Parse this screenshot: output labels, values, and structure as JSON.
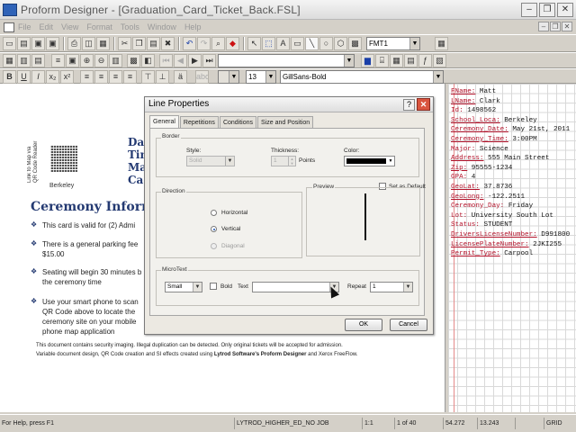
{
  "app": {
    "title": "Proform Designer - [Graduation_Card_Ticket_Back.FSL]"
  },
  "menu": [
    "File",
    "Edit",
    "View",
    "Format",
    "Tools",
    "Window",
    "Help"
  ],
  "toolbar": {
    "format_combo": "FMT1",
    "font_size": "13",
    "font_name": "GillSans-Bold",
    "field_combo": ""
  },
  "document": {
    "qr_side_text": "Link to Map via QR Code Reader",
    "qr_caption": "Berkeley",
    "header_lines": [
      "Da",
      "Tin",
      "Ma",
      "Ca"
    ],
    "section_title": "Ceremony Inform",
    "bullets": [
      [
        "This card is valid for (2) Admi"
      ],
      [
        "There is a general parking fee",
        "$15.00"
      ],
      [
        "Seating will begin 30 minutes b",
        "the ceremony time"
      ],
      [
        "Use your smart phone to scan",
        "QR Code  above to locate the",
        "ceremony site on your mobile",
        "phone map application"
      ]
    ],
    "footer_1": "This document contains security imaging.  Illegal duplication can be detected.  Only original tickets will be accepted for admission.",
    "footer_2_pre": "Variable document design, QR Code creation and SI effects created using ",
    "footer_2_bold": "Lytrod Software's Proform Designer",
    "footer_2_post": " and Xerox FreeFlow."
  },
  "data_panel": [
    {
      "key": "FName:",
      "value": "Matt"
    },
    {
      "key": "LName:",
      "value": "Clark"
    },
    {
      "key": "Id:",
      "value": "1498562"
    },
    {
      "key": "School_Loca:",
      "value": "Berkeley"
    },
    {
      "key": "Ceremony_Date:",
      "value": "May 21st, 2011"
    },
    {
      "key": "Ceremony_Time:",
      "value": "3:00PM"
    },
    {
      "key": "Major:",
      "value": "Science"
    },
    {
      "key": "Address:",
      "value": "555 Main Street"
    },
    {
      "key": "Zip:",
      "value": "95555-1234"
    },
    {
      "key": "GPA:",
      "value": "4"
    },
    {
      "key": "GeoLat:",
      "value": "37.8736"
    },
    {
      "key": "GeoLong:",
      "value": "-122.2511"
    },
    {
      "key": "Ceremony_Day:",
      "value": "Friday"
    },
    {
      "key": "Lot:",
      "value": "University South Lot"
    },
    {
      "key": "Status:",
      "value": "STUDENT"
    },
    {
      "key": "DriversLicenseNumber:",
      "value": "D991800"
    },
    {
      "key": "LicensePlateNumber:",
      "value": "2JKI255"
    },
    {
      "key": "Permit_Type:",
      "value": "Carpool"
    }
  ],
  "status_bar": {
    "help": "For Help, press F1",
    "job": "LYTROD_HIGHER_ED_NO JOB",
    "zoom": "1:1",
    "page": "1 of 40",
    "x": "54.272",
    "y": "13.243",
    "mode": "GRID"
  },
  "dialog": {
    "title": "Line Properties",
    "help_label": "?",
    "close_label": "✕",
    "tabs": [
      "General",
      "Repetitions",
      "Conditions",
      "Size and Position"
    ],
    "border_group": "Border",
    "style_label": "Style:",
    "style_value": "Solid",
    "thickness_label": "Thickness:",
    "thickness_value": "1",
    "thickness_unit": "Points",
    "color_label": "Color:",
    "color_value": "#000000",
    "set_as_default": "Set as Default",
    "direction_group": "Direction",
    "direction_options": [
      "Horizontal",
      "Vertical",
      "Diagonal"
    ],
    "direction_selected": "Vertical",
    "preview_group": "Preview",
    "microtext_group": "MicroText",
    "micro_size": "Small",
    "bold_label": "Bold",
    "text_label": "Text",
    "text_value": "",
    "repeat_label": "Repeat",
    "repeat_value": "1",
    "ok_label": "OK",
    "cancel_label": "Cancel"
  }
}
